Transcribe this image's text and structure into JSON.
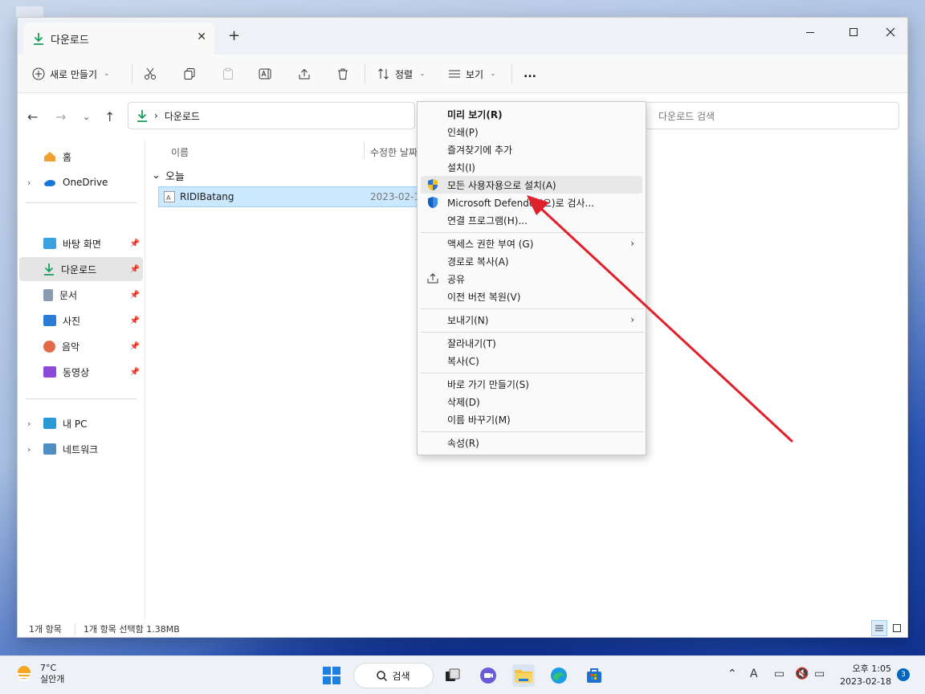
{
  "window": {
    "tab_title": "다운로드",
    "tab_close": "✕",
    "new_tab": "+"
  },
  "toolbar": {
    "new_label": "새로 만들기",
    "sort_label": "정렬",
    "view_label": "보기",
    "more_label": "..."
  },
  "address": {
    "path": "다운로드",
    "search_placeholder": "다운로드 검색"
  },
  "sidebar": {
    "items": [
      {
        "label": "홈",
        "icon": "home-icon"
      },
      {
        "label": "OneDrive",
        "icon": "cloud-icon"
      },
      {
        "label": "바탕 화면",
        "icon": "desktop-icon"
      },
      {
        "label": "다운로드",
        "icon": "download-icon"
      },
      {
        "label": "문서",
        "icon": "document-icon"
      },
      {
        "label": "사진",
        "icon": "picture-icon"
      },
      {
        "label": "음악",
        "icon": "music-icon"
      },
      {
        "label": "동영상",
        "icon": "video-icon"
      },
      {
        "label": "내 PC",
        "icon": "pc-icon"
      },
      {
        "label": "네트워크",
        "icon": "network-icon"
      }
    ]
  },
  "content": {
    "columns": [
      "이름",
      "수정한 날짜"
    ],
    "group": "오늘",
    "files": [
      {
        "name": "RIDIBatang",
        "date": "2023-02-1"
      }
    ]
  },
  "status": {
    "count": "1개 항목",
    "selected": "1개 항목 선택함 1.38MB"
  },
  "context_menu": {
    "items": [
      "미리 보기(R)",
      "인쇄(P)",
      "즐겨찾기에 추가",
      "설치(I)",
      "모든 사용자용으로 설치(A)",
      "Microsoft Defender(으)로 검사...",
      "연결 프로그램(H)...",
      "액세스 권한 부여 (G)",
      "경로로 복사(A)",
      "공유",
      "이전 버전 복원(V)",
      "보내기(N)",
      "잘라내기(T)",
      "복사(C)",
      "바로 가기 만들기(S)",
      "삭제(D)",
      "이름 바꾸기(M)",
      "속성(R)"
    ]
  },
  "taskbar": {
    "temperature": "7°C",
    "weather": "실안개",
    "search_label": "검색",
    "time": "오후 1:05",
    "date": "2023-02-18",
    "badge": "3"
  },
  "colors": {
    "accent": "#0067c0",
    "selection": "#cce8ff",
    "annotation": "#e0202a"
  }
}
